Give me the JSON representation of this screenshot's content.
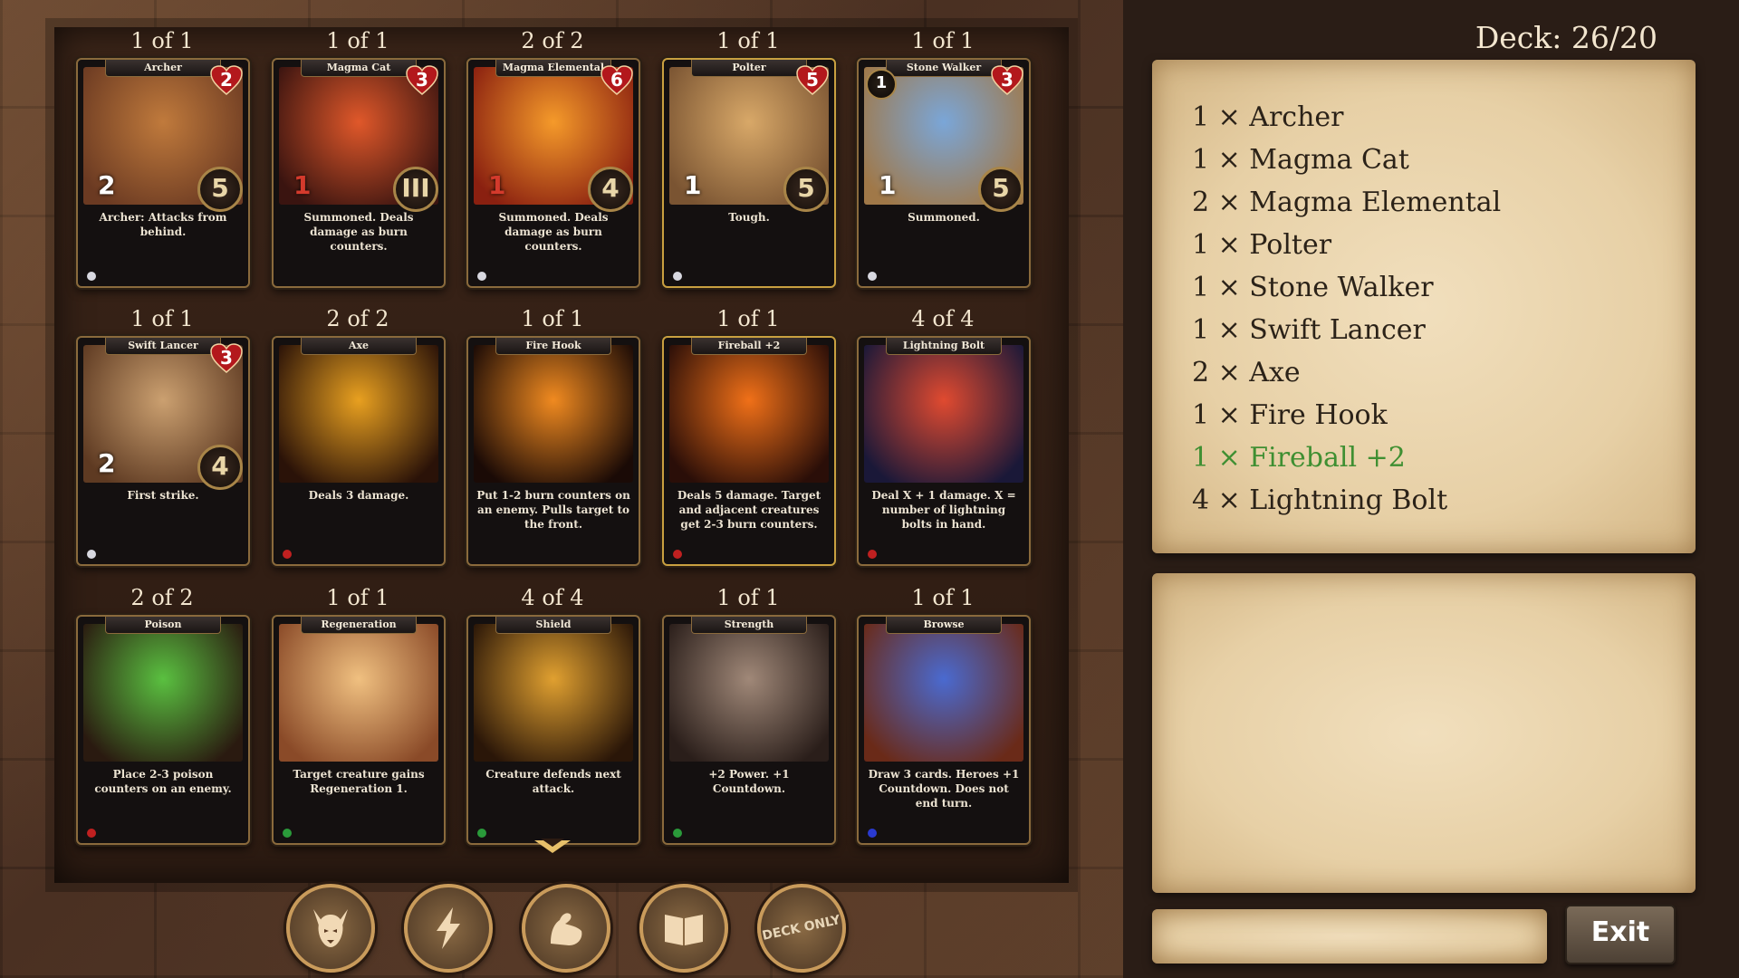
{
  "deck_count": "Deck: 26/20",
  "deck_list": [
    {
      "text": "1 × Archer",
      "highlight": false
    },
    {
      "text": "1 × Magma Cat",
      "highlight": false
    },
    {
      "text": "2 × Magma Elemental",
      "highlight": false
    },
    {
      "text": "1 × Polter",
      "highlight": false
    },
    {
      "text": "1 × Stone Walker",
      "highlight": false
    },
    {
      "text": "1 × Swift Lancer",
      "highlight": false
    },
    {
      "text": "2 × Axe",
      "highlight": false
    },
    {
      "text": "1 × Fire Hook",
      "highlight": false
    },
    {
      "text": "1 × Fireball +2",
      "highlight": true
    },
    {
      "text": "4 × Lightning Bolt",
      "highlight": false
    }
  ],
  "exit_label": "Exit",
  "deck_only_label": "DECK ONLY",
  "cards": [
    {
      "count": "1 of 1",
      "name": "Archer",
      "text": "Archer: Attacks from behind.",
      "health": "2",
      "cost": "5",
      "power": "2",
      "power_red": false,
      "badge": "",
      "art": [
        "#c07a3c",
        "#6b3a22"
      ],
      "gem": "#d8d8e0",
      "gold": false
    },
    {
      "count": "1 of 1",
      "name": "Magma Cat",
      "text": "Summoned. Deals damage as burn counters.",
      "health": "3",
      "cost": "III",
      "power": "1",
      "power_red": true,
      "badge": "",
      "art": [
        "#e0582a",
        "#3a1410"
      ],
      "gem": "",
      "gold": false
    },
    {
      "count": "2 of 2",
      "name": "Magma Elemental",
      "text": "Summoned. Deals damage as burn counters.",
      "health": "6",
      "cost": "4",
      "power": "1",
      "power_red": true,
      "badge": "",
      "art": [
        "#f59a2a",
        "#8a2010"
      ],
      "gem": "#d8d8e0",
      "gold": false
    },
    {
      "count": "1 of 1",
      "name": "Polter",
      "text": "Tough.",
      "health": "5",
      "cost": "5",
      "power": "1",
      "power_red": false,
      "badge": "",
      "art": [
        "#d8a868",
        "#7a5432"
      ],
      "gem": "#d8d8e0",
      "gold": true
    },
    {
      "count": "1 of 1",
      "name": "Stone Walker",
      "text": "Summoned.",
      "health": "3",
      "cost": "5",
      "power": "1",
      "power_red": false,
      "badge": "1",
      "art": [
        "#7aa6d8",
        "#a07848"
      ],
      "gem": "#d8d8e0",
      "gold": false
    },
    {
      "count": "1 of 1",
      "name": "Swift Lancer",
      "text": "First strike.",
      "health": "3",
      "cost": "4",
      "power": "2",
      "power_red": false,
      "badge": "",
      "art": [
        "#cba070",
        "#5e3a22"
      ],
      "gem": "#d8d8e0",
      "gold": false
    },
    {
      "count": "2 of 2",
      "name": "Axe",
      "text": "Deals 3 damage.",
      "health": "",
      "cost": "",
      "power": "",
      "power_red": false,
      "badge": "",
      "art": [
        "#e8a020",
        "#2a1208"
      ],
      "gem": "#c02020",
      "gold": false
    },
    {
      "count": "1 of 1",
      "name": "Fire Hook",
      "text": "Put 1-2 burn counters on an enemy. Pulls target to the front.",
      "health": "",
      "cost": "",
      "power": "",
      "power_red": false,
      "badge": "",
      "art": [
        "#f08a20",
        "#1a0a06"
      ],
      "gem": "",
      "gold": false
    },
    {
      "count": "1 of 1",
      "name": "Fireball +2",
      "text": "Deals 5 damage. Target and adjacent creatures get 2-3 burn counters.",
      "health": "",
      "cost": "",
      "power": "",
      "power_red": false,
      "badge": "",
      "art": [
        "#f07018",
        "#2a0e08"
      ],
      "gem": "#c02020",
      "gold": true
    },
    {
      "count": "4 of 4",
      "name": "Lightning Bolt",
      "text": "Deal X + 1 damage. X = number of lightning bolts in hand.",
      "health": "",
      "cost": "",
      "power": "",
      "power_red": false,
      "badge": "",
      "art": [
        "#e04a30",
        "#1a1838"
      ],
      "gem": "#c02020",
      "gold": false
    },
    {
      "count": "2 of 2",
      "name": "Poison",
      "text": "Place 2-3 poison counters on an enemy.",
      "health": "",
      "cost": "",
      "power": "",
      "power_red": false,
      "badge": "",
      "art": [
        "#5ac040",
        "#2a1a10"
      ],
      "gem": "#c02020",
      "gold": false
    },
    {
      "count": "1 of 1",
      "name": "Regeneration",
      "text": "Target creature gains Regeneration 1.",
      "health": "",
      "cost": "",
      "power": "",
      "power_red": false,
      "badge": "",
      "art": [
        "#f0c080",
        "#8a4a28"
      ],
      "gem": "#2a9a3a",
      "gold": false
    },
    {
      "count": "4 of 4",
      "name": "Shield",
      "text": "Creature defends next attack.",
      "health": "",
      "cost": "",
      "power": "",
      "power_red": false,
      "badge": "",
      "art": [
        "#e0a030",
        "#2a1608"
      ],
      "gem": "#2a9a3a",
      "gold": false
    },
    {
      "count": "1 of 1",
      "name": "Strength",
      "text": "+2 Power. +1 Countdown.",
      "health": "",
      "cost": "",
      "power": "",
      "power_red": false,
      "badge": "",
      "art": [
        "#a08878",
        "#2a1e1a"
      ],
      "gem": "#2a9a3a",
      "gold": false
    },
    {
      "count": "1 of 1",
      "name": "Browse",
      "text": "Draw 3 cards. Heroes +1 Countdown. Does not end turn.",
      "health": "",
      "cost": "",
      "power": "",
      "power_red": false,
      "badge": "",
      "art": [
        "#4a6ad0",
        "#6a2a18"
      ],
      "gem": "#2a3ad0",
      "gold": false
    }
  ],
  "filters": [
    {
      "icon": "demon-icon"
    },
    {
      "icon": "lightning-icon"
    },
    {
      "icon": "strength-icon"
    },
    {
      "icon": "book-icon"
    },
    {
      "icon": "deck-only-icon"
    }
  ]
}
